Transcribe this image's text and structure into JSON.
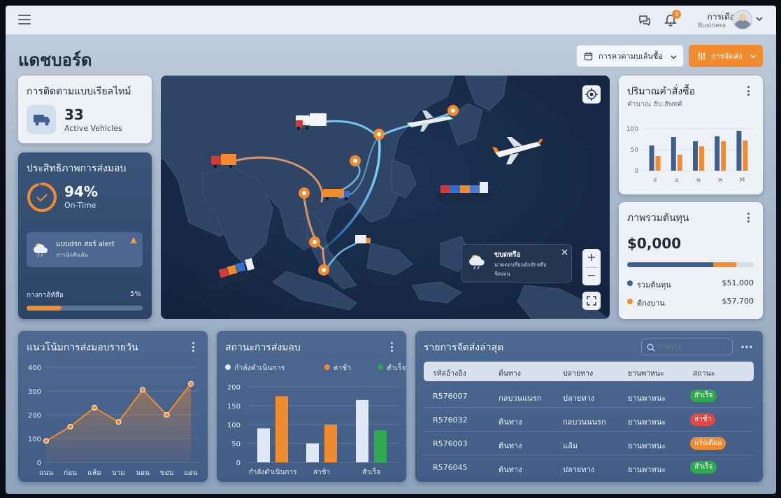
{
  "header": {
    "notification_count": "3",
    "user_name": "การเดือ",
    "user_role": "Business",
    "icons": [
      "menu-icon",
      "chat-icon",
      "bell-icon",
      "chevron-down-icon"
    ]
  },
  "page": {
    "title": "แดชบอร์ด",
    "date_filter_label": "การควตามบเล้นชื้อ",
    "ship_button_label": "การจัดส่ง"
  },
  "colors": {
    "accent": "#f28a2e",
    "primary": "#3f5f8f",
    "success": "#2fa84f",
    "danger": "#e04848",
    "warning": "#f28a2e"
  },
  "realtime": {
    "title": "การติดตามแบบเรียลไทม์",
    "count": "33",
    "label": "Active Vehicles"
  },
  "efficiency": {
    "title": "ประสิทธิภาพการส่งมอบ",
    "percent": "94%",
    "label": "On-Time",
    "ratio": 0.94,
    "alert_title": "แบบdรก สอร์ alert",
    "alert_sub": "การนักสังเล้น",
    "progress_label": "กางกาอ้ทัสือ",
    "progress_value": "5%",
    "progress_ratio": 0.05
  },
  "map": {
    "weather_title": "ขบดหรือ",
    "weather_line1": "นาดตอบที่ยอดักสักหลือ",
    "weather_line2": "ชิตเพ่น",
    "zoom_in": "+",
    "zoom_out": "−"
  },
  "order_volume": {
    "title": "ปริมาณคำสั่งซื้อ",
    "subtitle": "คำนาณ ลับ.สัพทศ์"
  },
  "cost": {
    "title": "ภาพรวมต้นทุน",
    "total": "$0,000",
    "bar_ratio": 0.68,
    "legend": [
      {
        "label": "รวมต้นทุน",
        "value": "$51,000",
        "color": "#3f5f8f"
      },
      {
        "label": "ต้กงบาน",
        "value": "$57,700",
        "color": "#f28a2e"
      }
    ]
  },
  "daily_trend": {
    "title": "แนวโน้มการส่งมอบรายวัน"
  },
  "delivery_status": {
    "title": "สถานะการส่งมอบ"
  },
  "shipments": {
    "title": "รายการจัดส่งล่าสุด",
    "search_placeholder": "ราสกาง",
    "columns": [
      "รหัสอ้างอิง",
      "ต้นทาง",
      "ปลายทาง",
      "ยานพาหนะ",
      "สถานะ"
    ],
    "rows": [
      {
        "id": "R576007",
        "origin": "กลบวนแนรก",
        "dest": "ปลายทาง",
        "vehicle": "ยานพาหนะ",
        "status": "สำเร็จ",
        "status_color": "#2fa84f"
      },
      {
        "id": "R576032",
        "origin": "ต้นทาง",
        "dest": "กลบวนนนรก",
        "vehicle": "ยานพาหนะ",
        "status": "ล่าช้า",
        "status_color": "#e04848"
      },
      {
        "id": "R576003",
        "origin": "ต้นทาง",
        "dest": "แล้ม",
        "vehicle": "ยานพาหนะ",
        "status": "แร้งเตือน",
        "status_color": "#f28a2e"
      },
      {
        "id": "R576045",
        "origin": "ต้นทาง",
        "dest": "ปลายทาง",
        "vehicle": "ยานพาหนะ",
        "status": "สำเร็จ",
        "status_color": "#2fa84f"
      }
    ]
  },
  "chart_data": [
    {
      "type": "bar",
      "title": "ปริมาณคำสั่งซื้อ",
      "categories": [
        "ส",
        "อ",
        "พ",
        "พ",
        "M"
      ],
      "series": [
        {
          "values": [
            60,
            80,
            70,
            82,
            95
          ],
          "color": "#3f5f8f"
        },
        {
          "values": [
            35,
            38,
            58,
            70,
            72
          ],
          "color": "#f28a2e"
        }
      ],
      "yticks": [
        0,
        50,
        100
      ],
      "ylim": [
        0,
        110
      ]
    },
    {
      "type": "line",
      "title": "แนวโน้มการส่งมอบรายวัน",
      "categories": [
        "แนน",
        "ก่อน",
        "แล้ม",
        "บาม",
        "นอน",
        "ขอบ",
        "แอน"
      ],
      "values": [
        90,
        150,
        230,
        170,
        305,
        200,
        330
      ],
      "yticks": [
        0,
        100,
        200,
        300,
        400
      ],
      "ylim": [
        0,
        400
      ],
      "color": "#f28a2e"
    },
    {
      "type": "bar",
      "title": "สถานะการส่งมอบ",
      "categories": [
        "กำลังดำเนินการ",
        "ล่าช้า",
        "สำเร็จ"
      ],
      "series": [
        {
          "name": "กำลังดำเนินการ",
          "color": "#dfe8f5",
          "values": [
            90,
            50,
            165
          ]
        },
        {
          "name": "ล่าช้า",
          "color": "#f28a2e",
          "values": [
            175,
            100,
            null
          ]
        },
        {
          "name": "สำเร็จ",
          "color": "#2fa84f",
          "values": [
            null,
            null,
            85
          ]
        }
      ],
      "yticks": [
        0,
        50,
        100,
        150,
        200
      ],
      "ylim": [
        0,
        200
      ]
    }
  ]
}
